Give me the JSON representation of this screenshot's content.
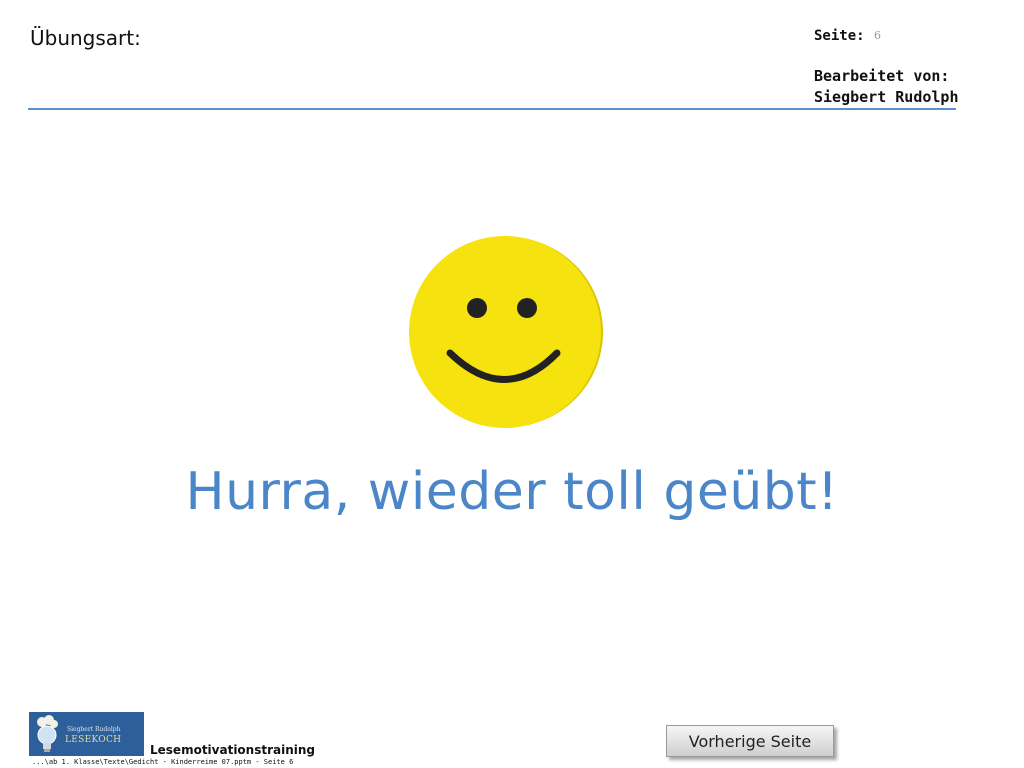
{
  "header": {
    "exercise_label": "Übungsart:",
    "page_label": "Seite:",
    "page_number": "6",
    "editor_label": "Bearbeitet von:",
    "editor_name": "Siegbert Rudolph"
  },
  "main": {
    "icon": "smiley-face-icon",
    "headline": "Hurra, wieder toll geübt!"
  },
  "footer": {
    "logo_icon": "lightbulb-logo-icon",
    "logo_author": "Siegbert Rudolph",
    "logo_brand": "LESEKOCH",
    "title": "Lesemotivationstraining",
    "path": "...\\ab 1. Klasse\\Texte\\Gedicht - Kinderreime 07.pptm - Seite 6",
    "prev_button_label": "Vorherige Seite"
  },
  "colors": {
    "accent_blue": "#4a86c8",
    "rule_blue": "#5b8fd0",
    "smiley_yellow": "#f5e20f",
    "logo_blue": "#2d5f9a"
  }
}
